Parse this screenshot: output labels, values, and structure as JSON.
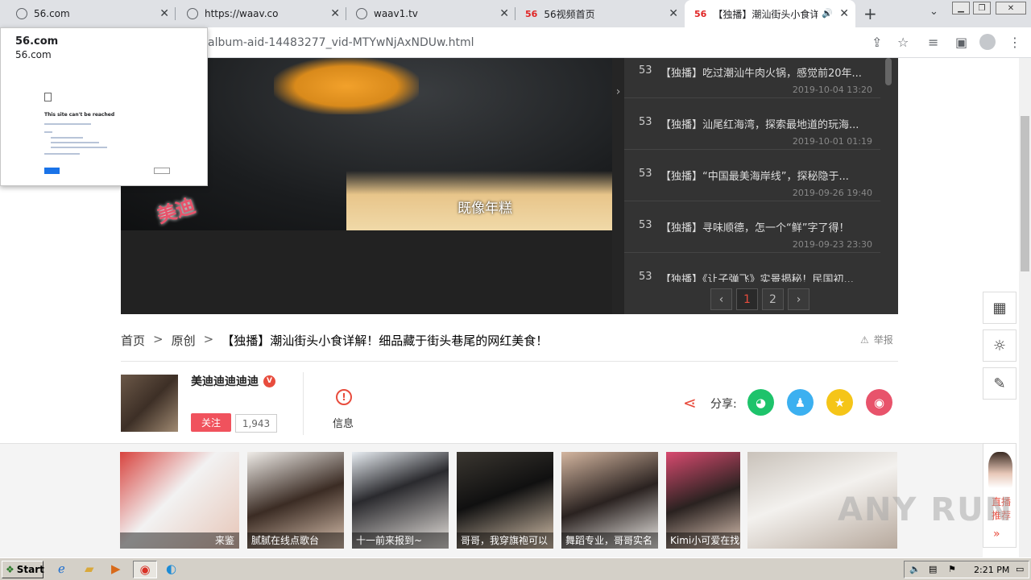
{
  "browser": {
    "tabs": [
      {
        "title": "56.com",
        "favicon": "globe-icon"
      },
      {
        "title": "https://waav.co",
        "favicon": "globe-icon"
      },
      {
        "title": "waav1.tv",
        "favicon": "globe-icon"
      },
      {
        "title": "56视频首页",
        "favicon": "56-logo"
      },
      {
        "title": "【独播】潮汕街头小食详解",
        "favicon": "56-logo",
        "active": true
      }
    ],
    "new_tab": "+",
    "url": "album-aid-14483277_vid-MTYwNjAxNDUw.html"
  },
  "popup": {
    "title": "56.com",
    "subtitle": "56.com",
    "error_title": "This site can't be reached"
  },
  "playlist": {
    "items": [
      {
        "num": "53",
        "title": "【独播】吃过潮汕牛肉火锅，感觉前20年...",
        "date": "2019-10-04 13:20"
      },
      {
        "num": "53",
        "title": "【独播】汕尾红海湾，探索最地道的玩海...",
        "date": "2019-10-01 01:19"
      },
      {
        "num": "53",
        "title": "【独播】“中国最美海岸线”，探秘隐于...",
        "date": "2019-09-26 19:40"
      },
      {
        "num": "53",
        "title": "【独播】寻味顺德，怎一个“鲜”字了得！",
        "date": "2019-09-23 23:30"
      },
      {
        "num": "53",
        "title": "【独播】《让子弹飞》实景揭秘！民国初...",
        "date": ""
      }
    ],
    "pager": {
      "prev": "‹",
      "pages": [
        "1",
        "2"
      ],
      "next": "›"
    }
  },
  "video": {
    "caption": "既像年糕",
    "logo_text": "美迪"
  },
  "breadcrumb": {
    "home": "首页",
    "sep": ">",
    "category": "原创",
    "title": "【独播】潮汕街头小食详解！细品藏于街头巷尾的网红美食！"
  },
  "report_label": "举报",
  "uploader": {
    "name": "美迪迪迪迪迪",
    "badge": "V",
    "follow_label": "关注",
    "follower_count": "1,943"
  },
  "info_label": "信息",
  "share": {
    "label": "分享:",
    "buttons": [
      {
        "name": "wechat-share-button",
        "icon": "wechat-icon",
        "color": "#1ec36b",
        "glyph": "◕"
      },
      {
        "name": "qq-share-button",
        "icon": "qq-icon",
        "color": "#3cb0f0",
        "glyph": "♟"
      },
      {
        "name": "qzone-share-button",
        "icon": "qzone-icon",
        "color": "#f5c518",
        "glyph": "★"
      },
      {
        "name": "weibo-share-button",
        "icon": "weibo-icon",
        "color": "#e8536b",
        "glyph": "◉"
      }
    ]
  },
  "side_tools": {
    "recommend_label": "直播推荐",
    "more": "»"
  },
  "thumbnails": [
    {
      "caption": "来鉴",
      "bg": "linear-gradient(135deg,#d8443f 0%,#f2f2f2 45%,#e7c6b8 100%)"
    },
    {
      "caption": "腻腻在线点歌台",
      "bg": "linear-gradient(160deg,#efece8 0%,#3b2c24 50%,#d9c1ae 100%)"
    },
    {
      "caption": "十一前来报到~",
      "bg": "linear-gradient(160deg,#e8edf2 0%,#2a2a2e 40%,#e9e4df 100%)"
    },
    {
      "caption": "哥哥，我穿旗袍可以",
      "bg": "linear-gradient(160deg,#3a3630 0%,#101010 45%,#d6c2ac 100%)"
    },
    {
      "caption": "舞蹈专业，哥哥实名",
      "bg": "linear-gradient(160deg,#d3b59f 0%,#2a2220 50%,#f1eeea 100%)"
    },
    {
      "caption": "Kimi小可爱在找",
      "bg": "linear-gradient(160deg,#d84a6f 0%,#2a2220 50%,#e0c7b7 100%)"
    },
    {
      "caption": "",
      "bg": "linear-gradient(160deg,#c9c2ba 0%,#f3f1ee 45%,#b7a99d 100%)"
    }
  ],
  "watermark": "ANY RUN",
  "taskbar": {
    "start_label": "Start",
    "time": "2:21 PM"
  }
}
